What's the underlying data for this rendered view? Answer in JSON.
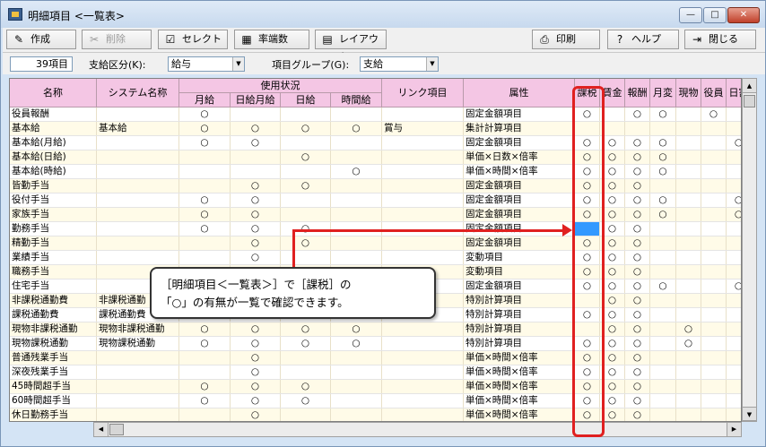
{
  "window": {
    "title": "明細項目 <一覧表>",
    "min": "—",
    "max": "□",
    "close": "✕"
  },
  "toolbar": {
    "create": "作成",
    "delete": "削除",
    "select": "セレクト",
    "rounding": "率端数",
    "layout": "レイアウト",
    "print": "印刷",
    "help": "ヘルプ",
    "close": "閉じる"
  },
  "filter": {
    "count": "39項目",
    "category_label": "支給区分(K):",
    "category_value": "給与",
    "group_label": "項目グループ(G):",
    "group_value": "支給"
  },
  "columns": {
    "name": "名称",
    "system_name": "システム名称",
    "usage": "使用状況",
    "monthly": "月給",
    "daily_monthly": "日給月給",
    "daily": "日給",
    "hourly": "時間給",
    "link": "リンク項目",
    "attribute": "属性",
    "taxable": "課税",
    "wage": "賃金",
    "remuneration": "報酬",
    "monthly_change": "月変",
    "in_kind": "現物",
    "officer": "役員",
    "daily_pay": "日割"
  },
  "rows": [
    {
      "name": "役員報酬",
      "sys": "",
      "m": "○",
      "dm": "",
      "d": "",
      "h": "",
      "link": "",
      "attr": "固定金額項目",
      "tax": "○",
      "wage": "",
      "rem": "○",
      "mc": "○",
      "kind": "",
      "off": "○",
      "dp": ""
    },
    {
      "name": "基本給",
      "sys": "基本給",
      "m": "○",
      "dm": "○",
      "d": "○",
      "h": "○",
      "link": "賞与",
      "attr": "集計計算項目",
      "tax": "",
      "wage": "",
      "rem": "",
      "mc": "",
      "kind": "",
      "off": "",
      "dp": ""
    },
    {
      "name": "基本給(月給)",
      "sys": "",
      "m": "○",
      "dm": "○",
      "d": "",
      "h": "",
      "link": "",
      "attr": "固定金額項目",
      "tax": "○",
      "wage": "○",
      "rem": "○",
      "mc": "○",
      "kind": "",
      "off": "",
      "dp": "○"
    },
    {
      "name": "基本給(日給)",
      "sys": "",
      "m": "",
      "dm": "",
      "d": "○",
      "h": "",
      "link": "",
      "attr": "単価×日数×倍率",
      "tax": "○",
      "wage": "○",
      "rem": "○",
      "mc": "○",
      "kind": "",
      "off": "",
      "dp": ""
    },
    {
      "name": "基本給(時給)",
      "sys": "",
      "m": "",
      "dm": "",
      "d": "",
      "h": "○",
      "link": "",
      "attr": "単価×時間×倍率",
      "tax": "○",
      "wage": "○",
      "rem": "○",
      "mc": "○",
      "kind": "",
      "off": "",
      "dp": ""
    },
    {
      "name": "皆勤手当",
      "sys": "",
      "m": "",
      "dm": "○",
      "d": "○",
      "h": "",
      "link": "",
      "attr": "固定金額項目",
      "tax": "○",
      "wage": "○",
      "rem": "○",
      "mc": "",
      "kind": "",
      "off": "",
      "dp": ""
    },
    {
      "name": "役付手当",
      "sys": "",
      "m": "○",
      "dm": "○",
      "d": "",
      "h": "",
      "link": "",
      "attr": "固定金額項目",
      "tax": "○",
      "wage": "○",
      "rem": "○",
      "mc": "○",
      "kind": "",
      "off": "",
      "dp": "○"
    },
    {
      "name": "家族手当",
      "sys": "",
      "m": "○",
      "dm": "○",
      "d": "",
      "h": "",
      "link": "",
      "attr": "固定金額項目",
      "tax": "○",
      "wage": "○",
      "rem": "○",
      "mc": "○",
      "kind": "",
      "off": "",
      "dp": "○"
    },
    {
      "name": "勤務手当",
      "sys": "",
      "m": "○",
      "dm": "○",
      "d": "○",
      "h": "",
      "link": "",
      "attr": "固定金額項目",
      "tax": "SEL",
      "wage": "○",
      "rem": "○",
      "mc": "",
      "kind": "",
      "off": "",
      "dp": ""
    },
    {
      "name": "精勤手当",
      "sys": "",
      "m": "",
      "dm": "○",
      "d": "○",
      "h": "",
      "link": "",
      "attr": "固定金額項目",
      "tax": "○",
      "wage": "○",
      "rem": "○",
      "mc": "",
      "kind": "",
      "off": "",
      "dp": ""
    },
    {
      "name": "業績手当",
      "sys": "",
      "m": "",
      "dm": "○",
      "d": "",
      "h": "",
      "link": "",
      "attr": "変動項目",
      "tax": "○",
      "wage": "○",
      "rem": "○",
      "mc": "",
      "kind": "",
      "off": "",
      "dp": ""
    },
    {
      "name": "職務手当",
      "sys": "",
      "m": "",
      "dm": "",
      "d": "",
      "h": "",
      "link": "",
      "attr": "変動項目",
      "tax": "○",
      "wage": "○",
      "rem": "○",
      "mc": "",
      "kind": "",
      "off": "",
      "dp": ""
    },
    {
      "name": "住宅手当",
      "sys": "",
      "m": "",
      "dm": "",
      "d": "",
      "h": "",
      "link": "",
      "attr": "固定金額項目",
      "tax": "○",
      "wage": "○",
      "rem": "○",
      "mc": "○",
      "kind": "",
      "off": "",
      "dp": "○"
    },
    {
      "name": "非課税通勤費",
      "sys": "非課税通勤",
      "m": "",
      "dm": "",
      "d": "",
      "h": "",
      "link": "",
      "attr": "特別計算項目",
      "tax": "",
      "wage": "○",
      "rem": "○",
      "mc": "",
      "kind": "",
      "off": "",
      "dp": ""
    },
    {
      "name": "課税通勤費",
      "sys": "課税通勤費",
      "m": "",
      "dm": "",
      "d": "",
      "h": "",
      "link": "",
      "attr": "特別計算項目",
      "tax": "○",
      "wage": "○",
      "rem": "○",
      "mc": "",
      "kind": "",
      "off": "",
      "dp": ""
    },
    {
      "name": "現物非課税通勤",
      "sys": "現物非課税通勤",
      "m": "○",
      "dm": "○",
      "d": "○",
      "h": "○",
      "link": "",
      "attr": "特別計算項目",
      "tax": "",
      "wage": "○",
      "rem": "○",
      "mc": "",
      "kind": "○",
      "off": "",
      "dp": ""
    },
    {
      "name": "現物課税通勤",
      "sys": "現物課税通勤",
      "m": "○",
      "dm": "○",
      "d": "○",
      "h": "○",
      "link": "",
      "attr": "特別計算項目",
      "tax": "○",
      "wage": "○",
      "rem": "○",
      "mc": "",
      "kind": "○",
      "off": "",
      "dp": ""
    },
    {
      "name": "普通残業手当",
      "sys": "",
      "m": "",
      "dm": "○",
      "d": "",
      "h": "",
      "link": "",
      "attr": "単価×時間×倍率",
      "tax": "○",
      "wage": "○",
      "rem": "○",
      "mc": "",
      "kind": "",
      "off": "",
      "dp": ""
    },
    {
      "name": "深夜残業手当",
      "sys": "",
      "m": "",
      "dm": "○",
      "d": "",
      "h": "",
      "link": "",
      "attr": "単価×時間×倍率",
      "tax": "○",
      "wage": "○",
      "rem": "○",
      "mc": "",
      "kind": "",
      "off": "",
      "dp": ""
    },
    {
      "name": "45時間超手当",
      "sys": "",
      "m": "○",
      "dm": "○",
      "d": "○",
      "h": "",
      "link": "",
      "attr": "単価×時間×倍率",
      "tax": "○",
      "wage": "○",
      "rem": "○",
      "mc": "",
      "kind": "",
      "off": "",
      "dp": ""
    },
    {
      "name": "60時間超手当",
      "sys": "",
      "m": "○",
      "dm": "○",
      "d": "○",
      "h": "",
      "link": "",
      "attr": "単価×時間×倍率",
      "tax": "○",
      "wage": "○",
      "rem": "○",
      "mc": "",
      "kind": "",
      "off": "",
      "dp": ""
    },
    {
      "name": "休日勤務手当",
      "sys": "",
      "m": "",
      "dm": "○",
      "d": "",
      "h": "",
      "link": "",
      "attr": "単価×時間×倍率",
      "tax": "○",
      "wage": "○",
      "rem": "○",
      "mc": "",
      "kind": "",
      "off": "",
      "dp": ""
    }
  ],
  "callout": {
    "line1": "［明細項目＜一覧表＞］で［課税］の",
    "line2": "「○」の有無が一覧で確認できます。"
  },
  "colors": {
    "accent_red": "#e02020",
    "header_pink": "#f4c6e4",
    "row_cream": "#fffbe8",
    "selected_blue": "#3399ff"
  }
}
